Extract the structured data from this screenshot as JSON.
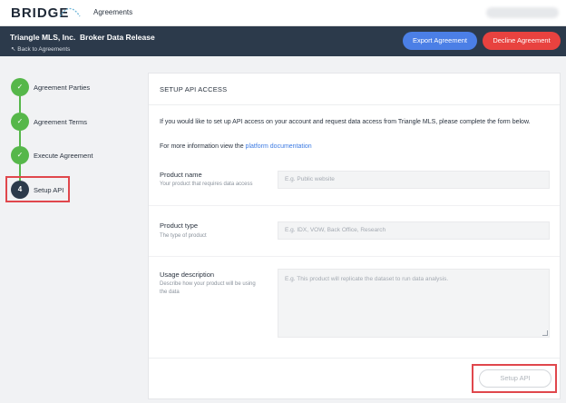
{
  "topbar": {
    "logo": "BRIDGE",
    "nav_link": "Agreements"
  },
  "header": {
    "org_name": "Triangle MLS, Inc.",
    "document_title": "Broker Data Release",
    "back_link": "↖ Back to Agreements",
    "export_label": "Export Agreement",
    "decline_label": "Decline Agreement"
  },
  "steps": [
    {
      "marker": "✓",
      "label": "Agreement Parties",
      "status": "complete"
    },
    {
      "marker": "✓",
      "label": "Agreement Terms",
      "status": "complete"
    },
    {
      "marker": "✓",
      "label": "Execute Agreement",
      "status": "complete"
    },
    {
      "marker": "4",
      "label": "Setup API",
      "status": "current"
    }
  ],
  "panel": {
    "title": "SETUP API ACCESS",
    "intro": "If you would like to set up API access on your account and request data access from Triangle MLS, please complete the form below.",
    "more_info_prefix": "For more information view the ",
    "more_info_link": "platform documentation",
    "fields": {
      "product_name": {
        "label": "Product name",
        "hint": "Your product that requires data access",
        "placeholder": "E.g. Public website"
      },
      "product_type": {
        "label": "Product type",
        "hint": "The type of product",
        "placeholder": "E.g. IDX, VOW, Back Office, Research"
      },
      "usage_description": {
        "label": "Usage description",
        "hint": "Describe how your product will be using the data",
        "placeholder": "E.g. This product will replicate the dataset to run data analysis."
      }
    },
    "submit_label": "Setup API"
  },
  "colors": {
    "header_bg": "#2c3a4b",
    "step_complete": "#56b74a",
    "export_button": "#4b7fe6",
    "decline_button": "#e8423f",
    "highlight": "#e0474c",
    "link": "#3d7be3"
  }
}
